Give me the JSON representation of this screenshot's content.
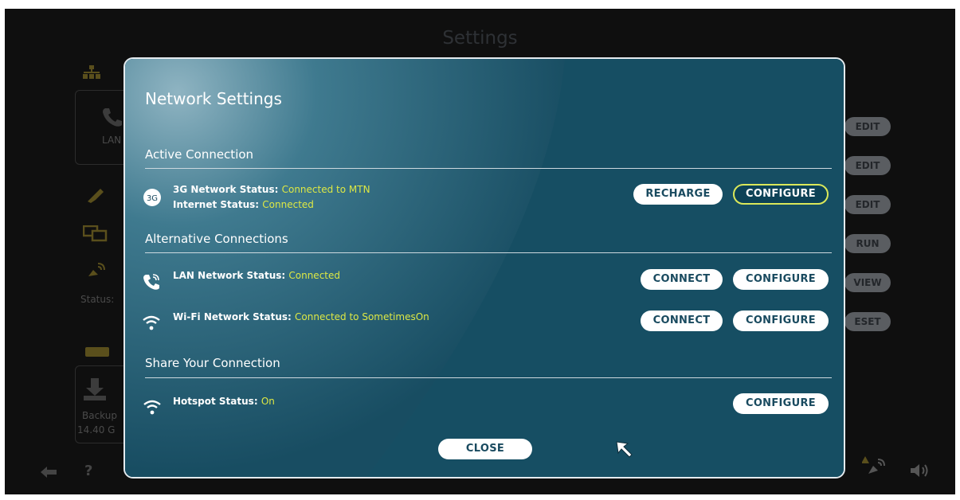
{
  "background": {
    "title": "Settings",
    "status_label": "Status:",
    "backup_label": "Backup",
    "backup_size": "14.40 G",
    "lan_partial": "LAN",
    "side_buttons": [
      "EDIT",
      "EDIT",
      "EDIT",
      "RUN",
      "VIEW",
      "ESET"
    ]
  },
  "dialog": {
    "title": "Network Settings",
    "active": {
      "heading": "Active Connection",
      "icon_label": "3G",
      "line1_label": "3G Network Status:",
      "line1_value": "Connected to MTN",
      "line2_label": "Internet Status:",
      "line2_value": "Connected",
      "recharge": "RECHARGE",
      "configure": "CONFIGURE"
    },
    "alternative": {
      "heading": "Alternative Connections",
      "lan": {
        "label": "LAN Network Status:",
        "value": "Connected",
        "connect": "CONNECT",
        "configure": "CONFIGURE"
      },
      "wifi": {
        "label": "Wi-Fi Network Status:",
        "value": "Connected to SometimesOn",
        "connect": "CONNECT",
        "configure": "CONFIGURE"
      }
    },
    "share": {
      "heading": "Share Your Connection",
      "label": "Hotspot Status:",
      "value": "On",
      "configure": "CONFIGURE"
    },
    "close": "CLOSE"
  },
  "colors": {
    "accent": "#dde844",
    "dialog_bg": "#164e63",
    "button_text": "#194a5f"
  },
  "icons": [
    "network-icon",
    "phone-icon",
    "usb-icon",
    "monitors-icon",
    "satellite-icon",
    "drive-icon",
    "download-icon",
    "arrow-left-icon",
    "help-icon",
    "warning-satellite-icon",
    "volume-icon",
    "cursor-icon"
  ]
}
